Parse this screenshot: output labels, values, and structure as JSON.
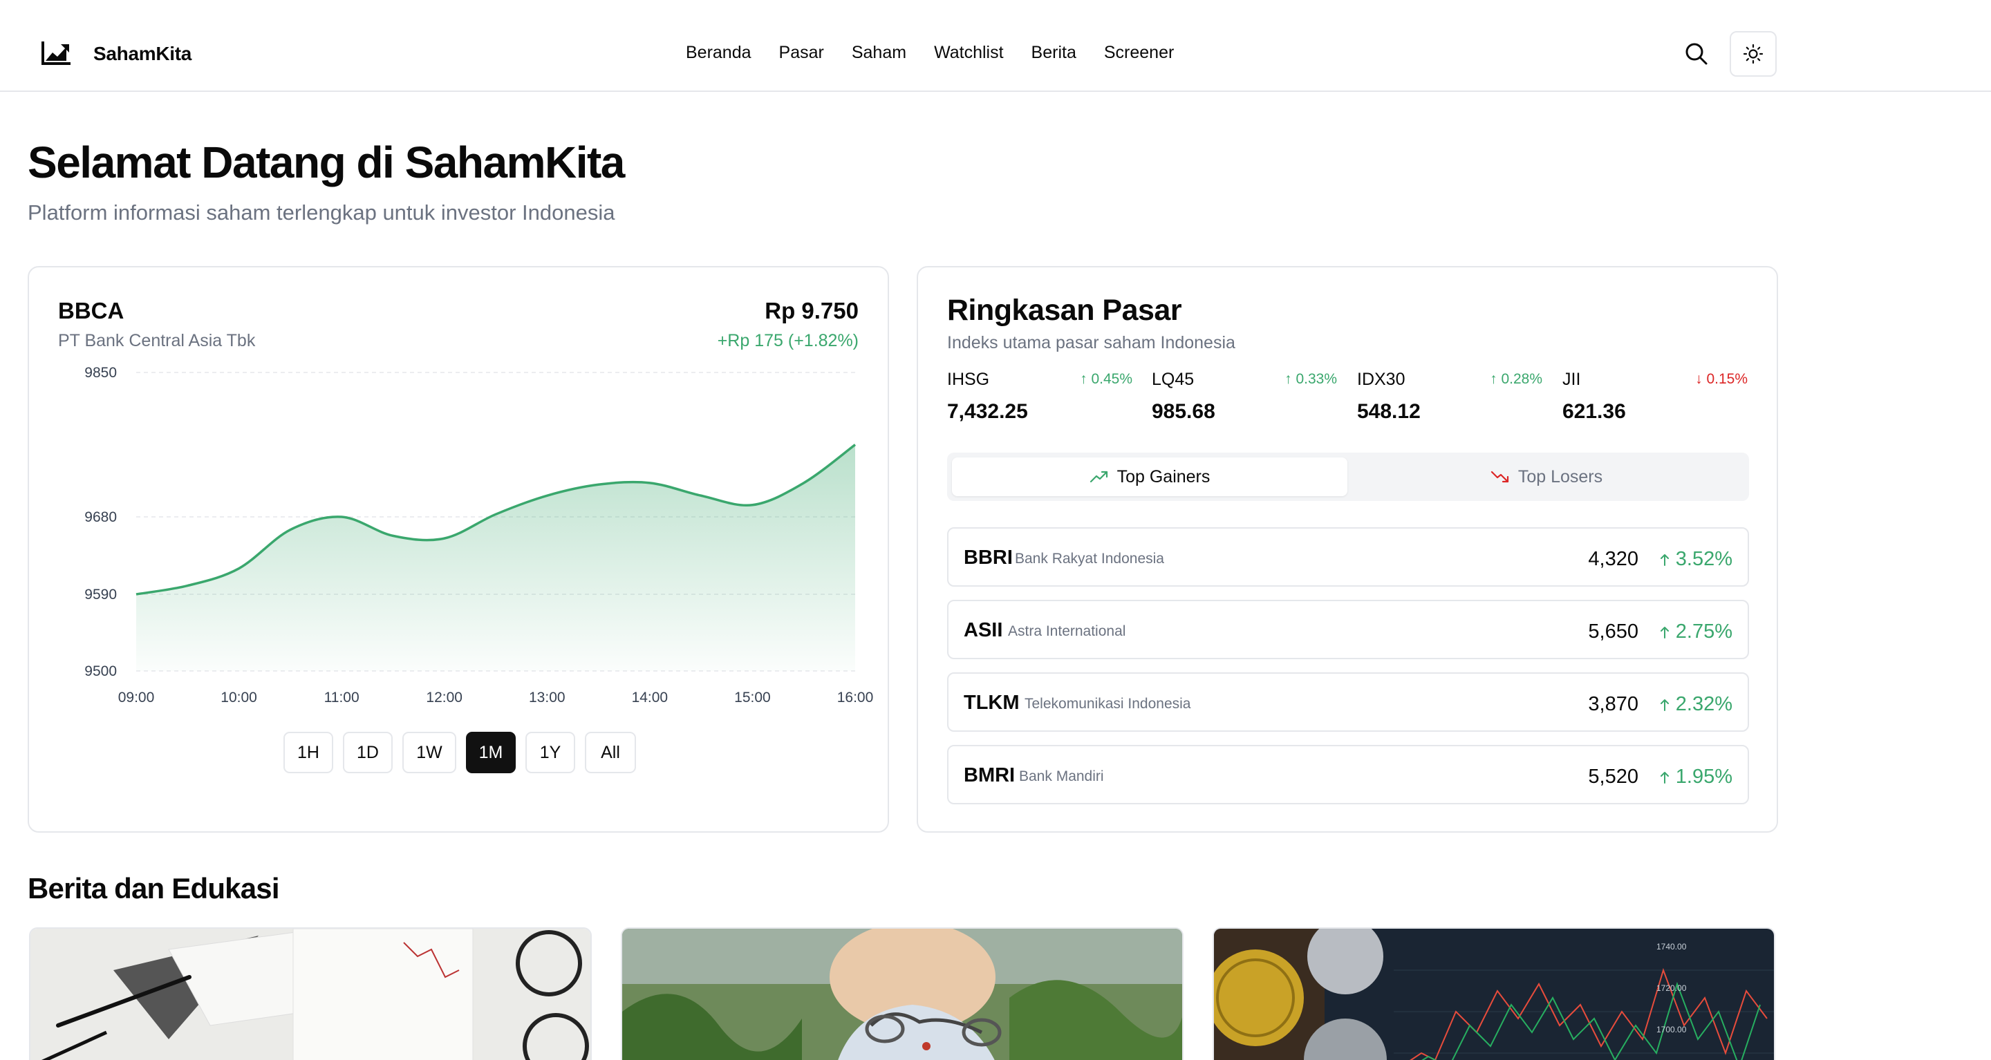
{
  "brand": {
    "name": "SahamKita"
  },
  "nav": {
    "items": [
      "Beranda",
      "Pasar",
      "Saham",
      "Watchlist",
      "Berita",
      "Screener"
    ]
  },
  "hero": {
    "title": "Selamat Datang di SahamKita",
    "subtitle": "Platform informasi saham terlengkap untuk investor Indonesia"
  },
  "stock": {
    "ticker": "BBCA",
    "name": "PT Bank Central Asia Tbk",
    "price": "Rp 9.750",
    "change": "+Rp 175 (+1.82%)",
    "ranges": [
      "1H",
      "1D",
      "1W",
      "1M",
      "1Y",
      "All"
    ],
    "active_range": "1M"
  },
  "chart_data": {
    "type": "area",
    "x": [
      "09:00",
      "09:30",
      "10:00",
      "10:30",
      "11:00",
      "11:30",
      "12:00",
      "12:30",
      "13:00",
      "13:30",
      "14:00",
      "14:30",
      "15:00",
      "15:30",
      "16:00"
    ],
    "series": [
      {
        "values": [
          9590,
          9600,
          9620,
          9665,
          9680,
          9658,
          9655,
          9683,
          9705,
          9718,
          9720,
          9705,
          9694,
          9720,
          9765
        ]
      }
    ],
    "y_ticks": [
      9500,
      9590,
      9680,
      9850
    ],
    "x_ticks": [
      "09:00",
      "10:00",
      "11:00",
      "12:00",
      "13:00",
      "14:00",
      "15:00",
      "16:00"
    ],
    "color": "#3aa76d",
    "grid": true
  },
  "market": {
    "title": "Ringkasan Pasar",
    "subtitle": "Indeks utama pasar saham Indonesia",
    "indices": [
      {
        "name": "IHSG",
        "change": "0.45%",
        "direction": "up",
        "value": "7,432.25"
      },
      {
        "name": "LQ45",
        "change": "0.33%",
        "direction": "up",
        "value": "985.68"
      },
      {
        "name": "IDX30",
        "change": "0.28%",
        "direction": "up",
        "value": "548.12"
      },
      {
        "name": "JII",
        "change": "0.15%",
        "direction": "down",
        "value": "621.36"
      }
    ],
    "tabs": {
      "gainers": "Top Gainers",
      "losers": "Top Losers"
    },
    "gainers": [
      {
        "code": "BBRI",
        "name": "Bank Rakyat Indonesia",
        "price": "4,320",
        "change": "3.52%"
      },
      {
        "code": "ASII",
        "name": "Astra International",
        "price": "5,650",
        "change": "2.75%"
      },
      {
        "code": "TLKM",
        "name": "Telekomunikasi Indonesia",
        "price": "3,870",
        "change": "2.32%"
      },
      {
        "code": "BMRI",
        "name": "Bank Mandiri",
        "price": "5,520",
        "change": "1.95%"
      }
    ]
  },
  "news": {
    "title": "Berita dan Edukasi"
  },
  "colors": {
    "up": "#3aa76d",
    "down": "#dc2626",
    "accent": "#111111"
  }
}
